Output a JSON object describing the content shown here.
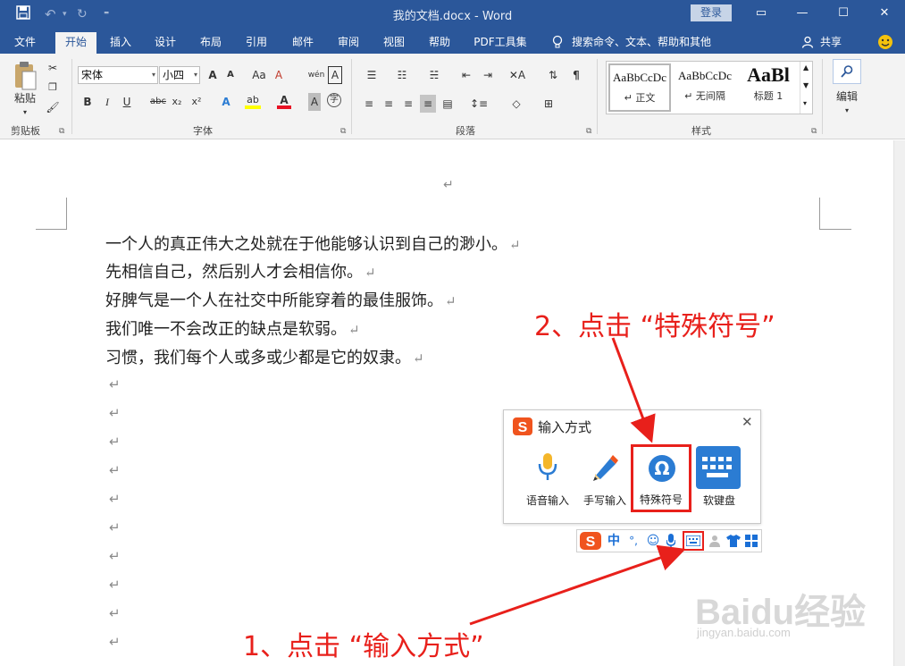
{
  "window": {
    "title": "我的文档.docx  -  Word",
    "login_label": "登录",
    "controls": {
      "restore_ribbon": "▭",
      "minimize": "—",
      "maximize": "☐",
      "close": "✕"
    }
  },
  "quick_access": {
    "save": "💾",
    "undo": "↶",
    "redo": "↻",
    "customize": "⁼"
  },
  "tabs": [
    "文件",
    "开始",
    "插入",
    "设计",
    "布局",
    "引用",
    "邮件",
    "审阅",
    "视图",
    "帮助",
    "PDF工具集"
  ],
  "active_tab": "开始",
  "tell_me": "搜索命令、文本、帮助和其他",
  "share_label": "共享",
  "ribbon": {
    "clipboard": {
      "paste_label": "粘贴",
      "group_label": "剪贴板"
    },
    "font": {
      "font_name": "宋体",
      "font_size": "小四",
      "group_label": "字体",
      "buttons": {
        "bold": "B",
        "italic": "I",
        "underline": "U",
        "strike": "abc",
        "subscript": "x₂",
        "superscript": "x²",
        "grow": "A",
        "shrink": "A",
        "change_case": "Aa",
        "clear": "A",
        "phonetic": "wén",
        "border": "A",
        "effects": "A",
        "highlight": "ab",
        "color": "A",
        "shading": "A",
        "enclose": "字"
      },
      "colors": {
        "highlight": "#ffff00",
        "font_color": "#e81123"
      }
    },
    "paragraph": {
      "group_label": "段落"
    },
    "styles": {
      "group_label": "样式",
      "items": [
        {
          "sample": "AaBbCcDc",
          "name": "↵ 正文"
        },
        {
          "sample": "AaBbCcDc",
          "name": "↵ 无间隔"
        },
        {
          "sample": "AaBl",
          "name": "标题 1"
        }
      ]
    },
    "editing": {
      "label": "编辑"
    }
  },
  "document": {
    "top_mark": "↵",
    "lines": [
      "一个人的真正伟大之处就在于他能够认识到自己的渺小。",
      "先相信自己，然后别人才会相信你。",
      "好脾气是一个人在社交中所能穿着的最佳服饰。",
      "我们唯一不会改正的缺点是软弱。",
      "习惯，我们每个人或多或少都是它的奴隶。"
    ],
    "pilcrow": "↵"
  },
  "popup": {
    "title": "输入方式",
    "close": "✕",
    "options": [
      {
        "label": "语音输入"
      },
      {
        "label": "手写输入"
      },
      {
        "label": "特殊符号"
      },
      {
        "label": "软键盘"
      }
    ]
  },
  "ime_bar": {
    "lang": "中",
    "punct": "°,",
    "emoji": "☺",
    "skin": "👕"
  },
  "annotations": {
    "step1": "1、点击 “输入方式”",
    "step2": "2、点击 “特殊符号”",
    "color": "#e8201b"
  },
  "watermark": {
    "text": "Baidu经验",
    "url": "jingyan.baidu.com"
  }
}
